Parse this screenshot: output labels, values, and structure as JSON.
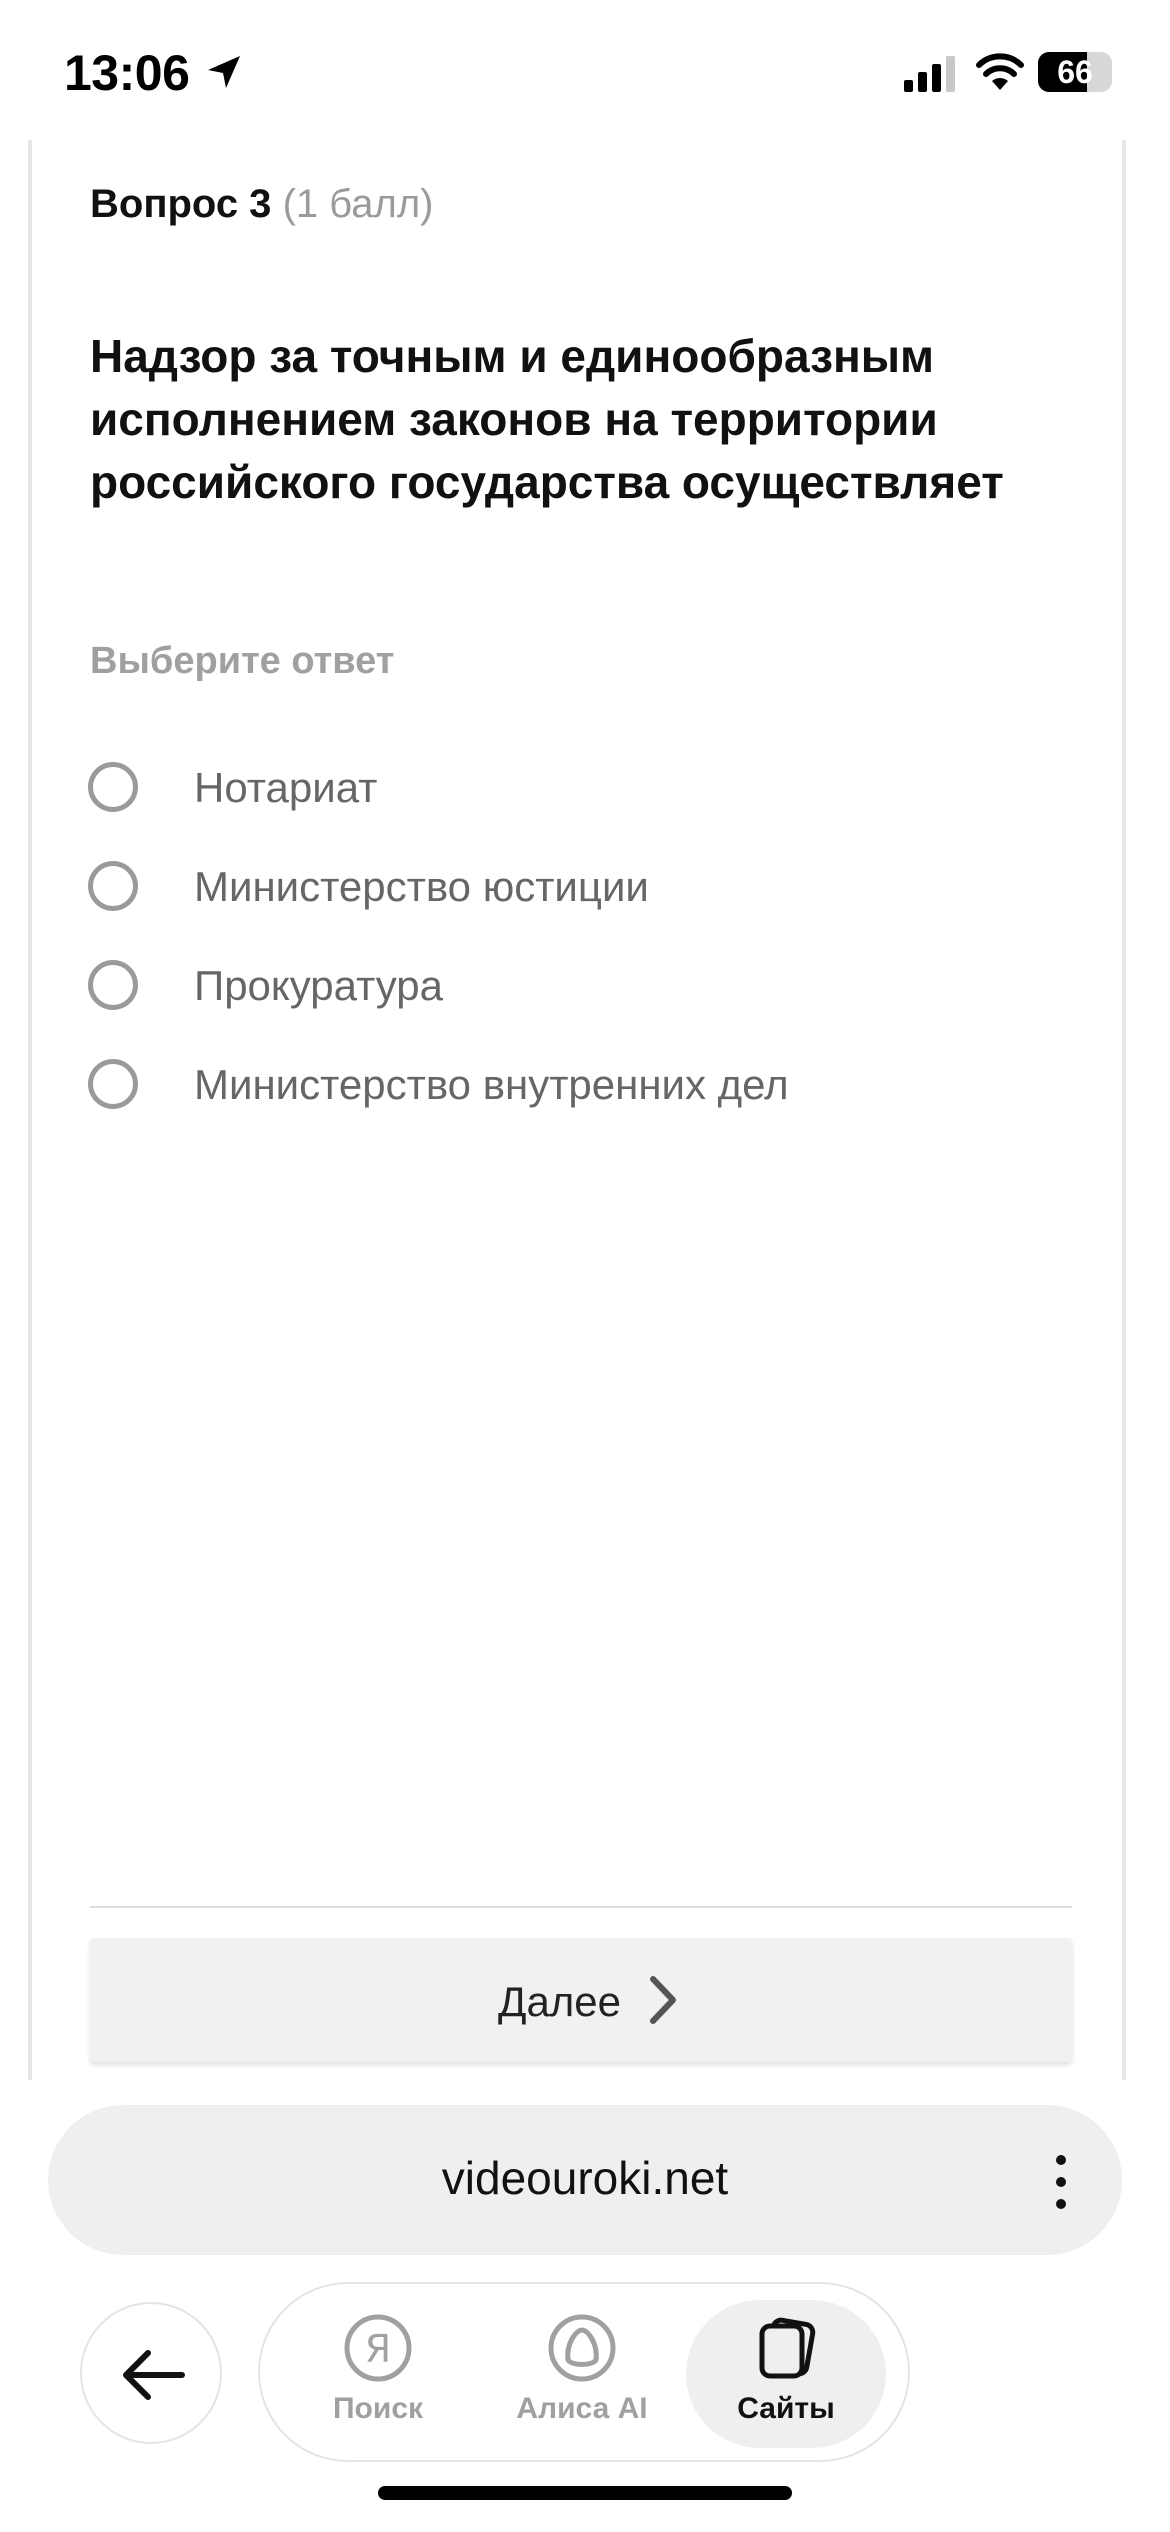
{
  "status_bar": {
    "time": "13:06",
    "battery": "66",
    "battery_level_percent": 66,
    "icons": [
      "location-arrow-icon",
      "cellular-signal-icon",
      "wifi-icon",
      "battery-icon"
    ]
  },
  "question": {
    "number_label": "Вопрос 3",
    "points": "(1 балл)",
    "text": "Надзор за точным и единообразным исполнением законов на территории российского государства осуществляет",
    "choose_label": "Выберите ответ",
    "options": [
      {
        "label": "Нотариат",
        "selected": false
      },
      {
        "label": "Министерство юстиции",
        "selected": false
      },
      {
        "label": "Прокуратура",
        "selected": false
      },
      {
        "label": "Министерство внутренних дел",
        "selected": false
      }
    ],
    "next_label": "Далее"
  },
  "browser": {
    "url": "videouroki.net",
    "menu_icon": "more-vertical-icon",
    "back_icon": "arrow-left-icon",
    "tabs": [
      {
        "label": "Поиск",
        "icon": "yandex-icon",
        "active": false
      },
      {
        "label": "Алиса AI",
        "icon": "alice-icon",
        "active": false
      },
      {
        "label": "Сайты",
        "icon": "sites-icon",
        "active": true
      }
    ]
  },
  "colors": {
    "text_primary": "#111111",
    "text_muted": "#9a9a9a",
    "radio_border": "#9a9a9a",
    "button_bg": "#f1f1f1",
    "url_bar_bg": "#efefef"
  }
}
